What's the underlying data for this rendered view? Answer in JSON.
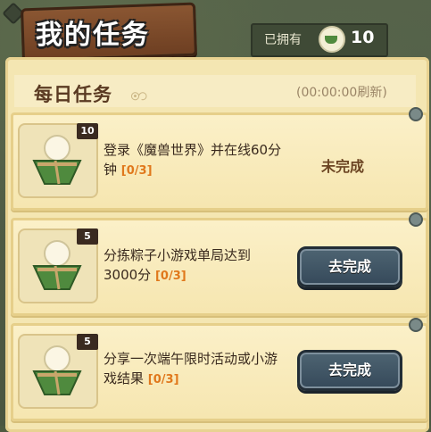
{
  "header": {
    "title": "我的任务",
    "owned_label": "已拥有",
    "owned_count": "10",
    "currency_icon": "zongzi-icon"
  },
  "section": {
    "title": "每日任务",
    "refresh_text": "(00:00:00刷新)"
  },
  "tasks": [
    {
      "reward_count": "10",
      "description": "登录《魔兽世界》并在线60分钟",
      "progress": "[0/3]",
      "status": "未完成",
      "action": null
    },
    {
      "reward_count": "5",
      "description": "分拣粽子小游戏单局达到3000分",
      "progress": "[0/3]",
      "status": null,
      "action": "去完成"
    },
    {
      "reward_count": "5",
      "description": "分享一次端午限时活动或小游戏结果",
      "progress": "[0/3]",
      "status": null,
      "action": "去完成"
    }
  ],
  "colors": {
    "panel": "#f4e6b2",
    "button": "#3f5566",
    "progress": "#e0781c"
  }
}
